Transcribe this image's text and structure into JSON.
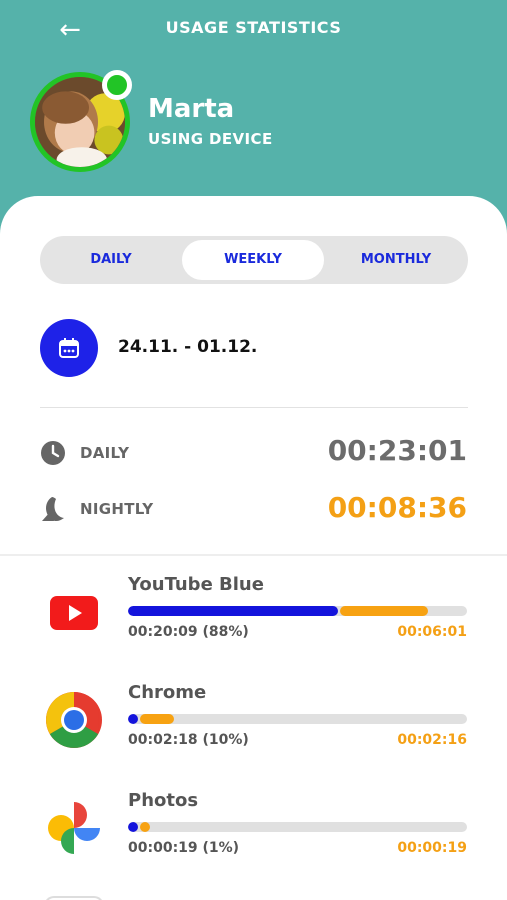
{
  "header": {
    "title": "USAGE STATISTICS",
    "back_icon": "arrow-left-icon",
    "background_color": "#55b2aa"
  },
  "profile": {
    "name": "Marta",
    "status": "USING DEVICE",
    "online": true,
    "online_color": "#22c426"
  },
  "tabs": [
    {
      "label": "DAILY",
      "selected": false
    },
    {
      "label": "WEEKLY",
      "selected": true
    },
    {
      "label": "MONTHLY",
      "selected": false
    }
  ],
  "date_range": {
    "icon": "calendar-icon",
    "text": "24.11. - 01.12."
  },
  "totals": {
    "daily": {
      "icon": "clock-icon",
      "label": "DAILY",
      "value": "00:23:01"
    },
    "nightly": {
      "icon": "moon-icon",
      "label": "NIGHTLY",
      "value": "00:08:36"
    }
  },
  "apps": [
    {
      "name": "YouTube Blue",
      "icon": "youtube-icon",
      "daily_text": "00:20:09 (88%)",
      "nightly_text": "00:06:01",
      "daily_fraction": 0.62,
      "nightly_fraction": 0.26
    },
    {
      "name": "Chrome",
      "icon": "chrome-icon",
      "daily_text": "00:02:18 (10%)",
      "nightly_text": "00:02:16",
      "daily_fraction": 0.03,
      "nightly_fraction": 0.1
    },
    {
      "name": "Photos",
      "icon": "photos-icon",
      "daily_text": "00:00:19 (1%)",
      "nightly_text": "00:00:19",
      "daily_fraction": 0.03,
      "nightly_fraction": 0.03
    }
  ],
  "colors": {
    "accent_blue": "#1414dc",
    "nightly_orange": "#f7a212",
    "daily_gray": "#6c6c6c"
  }
}
